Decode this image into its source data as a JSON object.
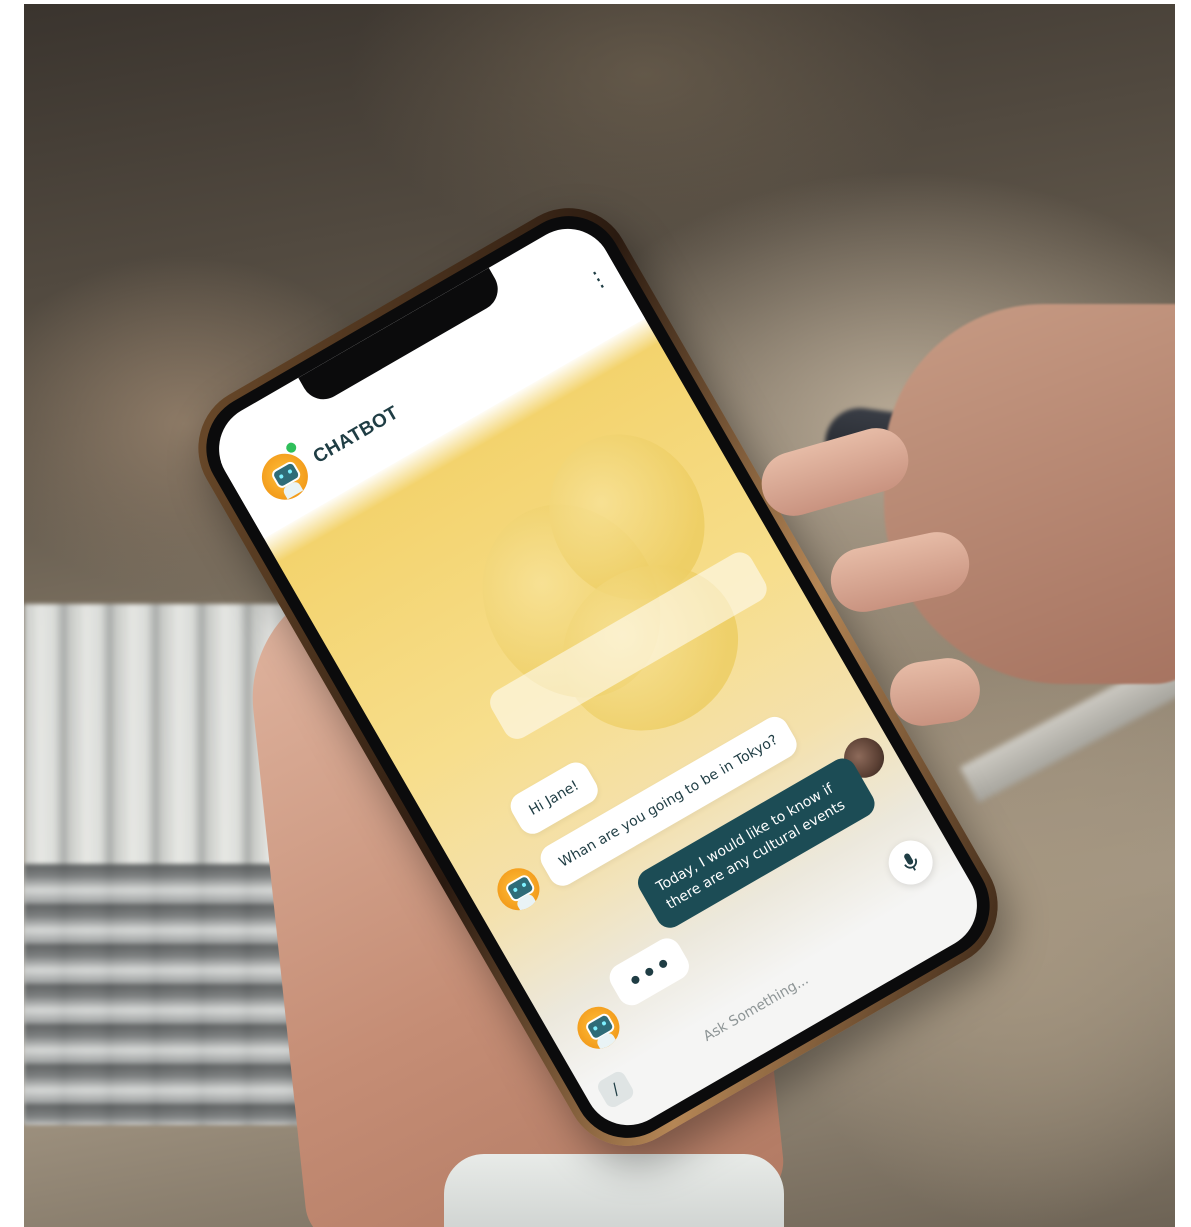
{
  "app": {
    "title": "CHATBOT"
  },
  "header": {
    "menu_icon": "more-vertical-icon",
    "status": "online"
  },
  "messages": [
    {
      "sender": "bot",
      "text": "Hi Jane!"
    },
    {
      "sender": "bot",
      "text": "Whan are you going to be in Tokyo?"
    },
    {
      "sender": "user",
      "text": "Today, I would like to know if there are any cultural events"
    },
    {
      "sender": "bot",
      "typing": true
    }
  ],
  "composer": {
    "placeholder": "Ask Something...",
    "attach_icon": "attach-icon",
    "mic_icon": "microphone-icon"
  },
  "colors": {
    "accent": "#1c4c55",
    "bot_avatar": "#f29a1a",
    "background_gradient": "#f3d36d",
    "online": "#2fbf5a"
  }
}
